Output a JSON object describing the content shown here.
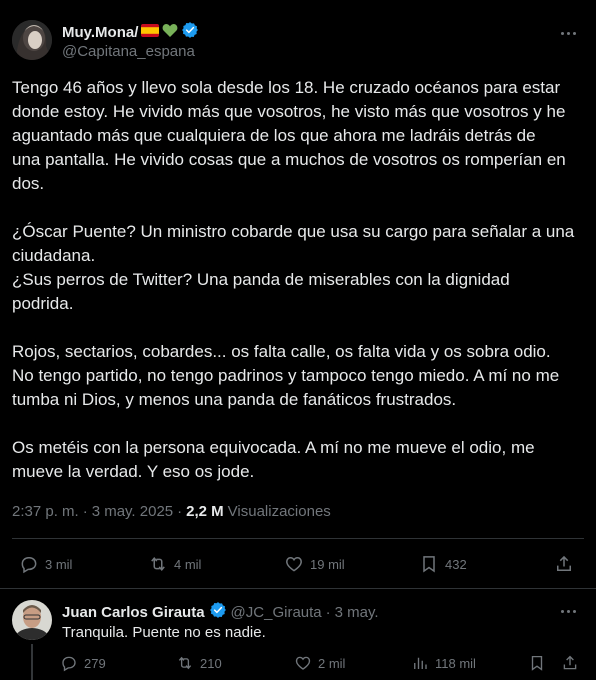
{
  "post": {
    "display_name": "Muy.Mona/",
    "name_emojis": [
      "spain-flag",
      "green-heart"
    ],
    "handle": "@Capitana_espana",
    "text": "Tengo 46 años y llevo sola desde los 18. He cruzado océanos para estar\ndonde estoy. He vivido más que vosotros, he visto más que vosotros y he\naguantado más que cualquiera de los que ahora me ladráis detrás de\nuna pantalla. He vivido cosas que a muchos de vosotros os romperían en\ndos.\n\n¿Óscar Puente? Un ministro cobarde que usa su cargo para señalar a una\nciudadana.\n¿Sus perros de Twitter? Una panda de miserables con la dignidad\npodrida.\n\nRojos, sectarios, cobardes... os falta calle, os falta vida y os sobra odio.\nNo tengo partido, no tengo padrinos y tampoco tengo miedo. A mí no me\ntumba ni Dios, y menos una panda de fanáticos frustrados.\n\nOs metéis con la persona equivocada. A mí no me mueve el odio, me\nmueve la verdad. Y eso os jode.",
    "time": "2:37 p. m.",
    "separator": "·",
    "date": "3 may. 2025",
    "views_count": "2,2 M",
    "views_label": "Visualizaciones",
    "replies": "3 mil",
    "reposts": "4 mil",
    "likes": "19 mil",
    "bookmarks": "432"
  },
  "reply": {
    "display_name": "Juan Carlos Girauta",
    "handle": "@JC_Girauta",
    "separator": "·",
    "date": "3 may.",
    "text": "Tranquila. Puente no es nadie.",
    "replies": "279",
    "reposts": "210",
    "likes": "2 mil",
    "views": "118 mil"
  },
  "colors": {
    "background": "#000000",
    "text": "#e7e9ea",
    "muted": "#71767b",
    "verified": "#1d9bf0",
    "divider": "#2f3336"
  }
}
